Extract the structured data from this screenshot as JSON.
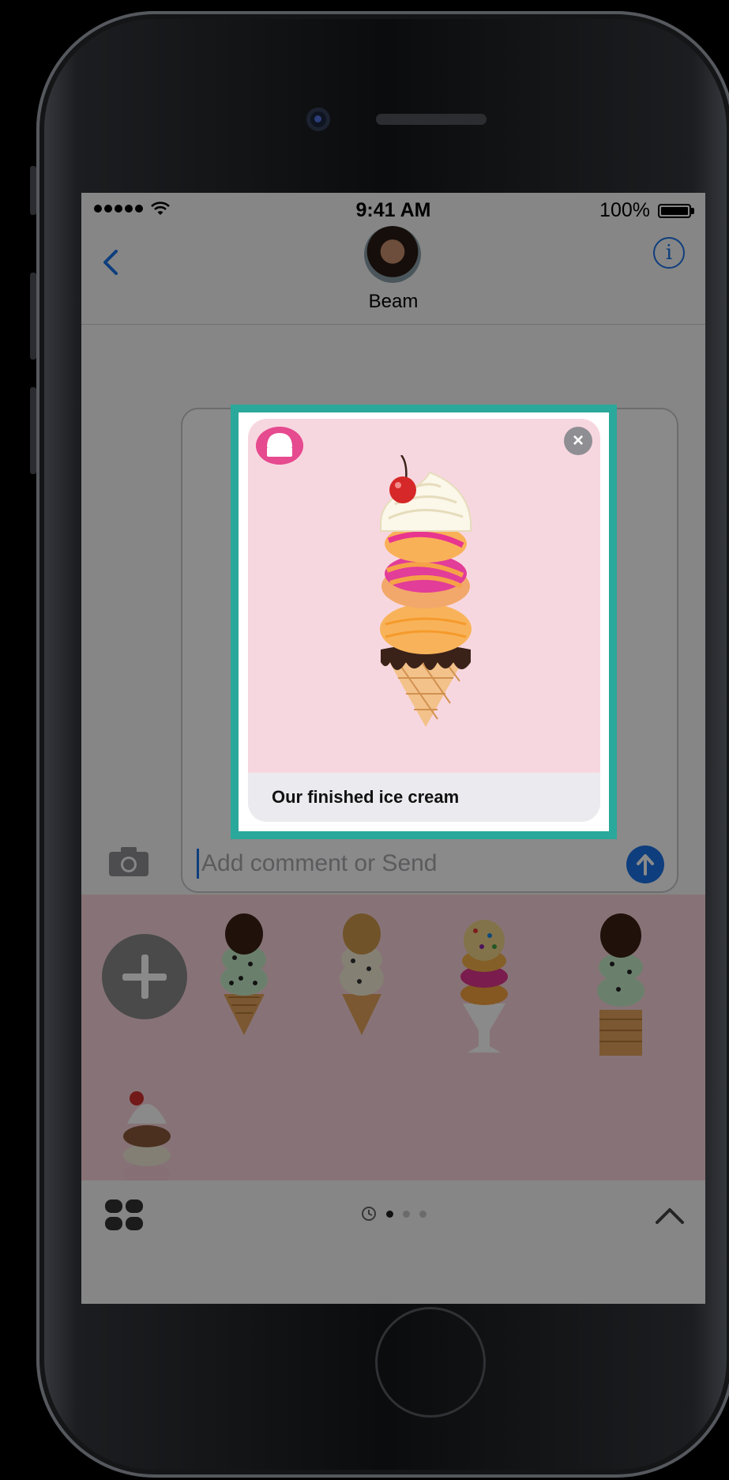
{
  "status_bar": {
    "time": "9:41 AM",
    "battery": "100%"
  },
  "conversation": {
    "contact_name": "Beam"
  },
  "compose": {
    "placeholder": "Add comment or Send"
  },
  "message_card": {
    "caption": "Our finished ice cream",
    "close_symbol": "×"
  },
  "tray": {
    "pages": 3,
    "active_page": 1
  },
  "colors": {
    "highlight": "#2aa89b",
    "accent": "#1a73e8",
    "drawer_bg": "#f9d5dc",
    "card_bg": "#f7d7df"
  },
  "icons": [
    "wifi-icon",
    "back-chevron-icon",
    "info-icon",
    "camera-icon",
    "send-arrow-icon",
    "close-icon",
    "plus-icon",
    "apps-icon",
    "recents-clock-icon",
    "chevron-up-icon",
    "ice-cream-app-icon"
  ]
}
